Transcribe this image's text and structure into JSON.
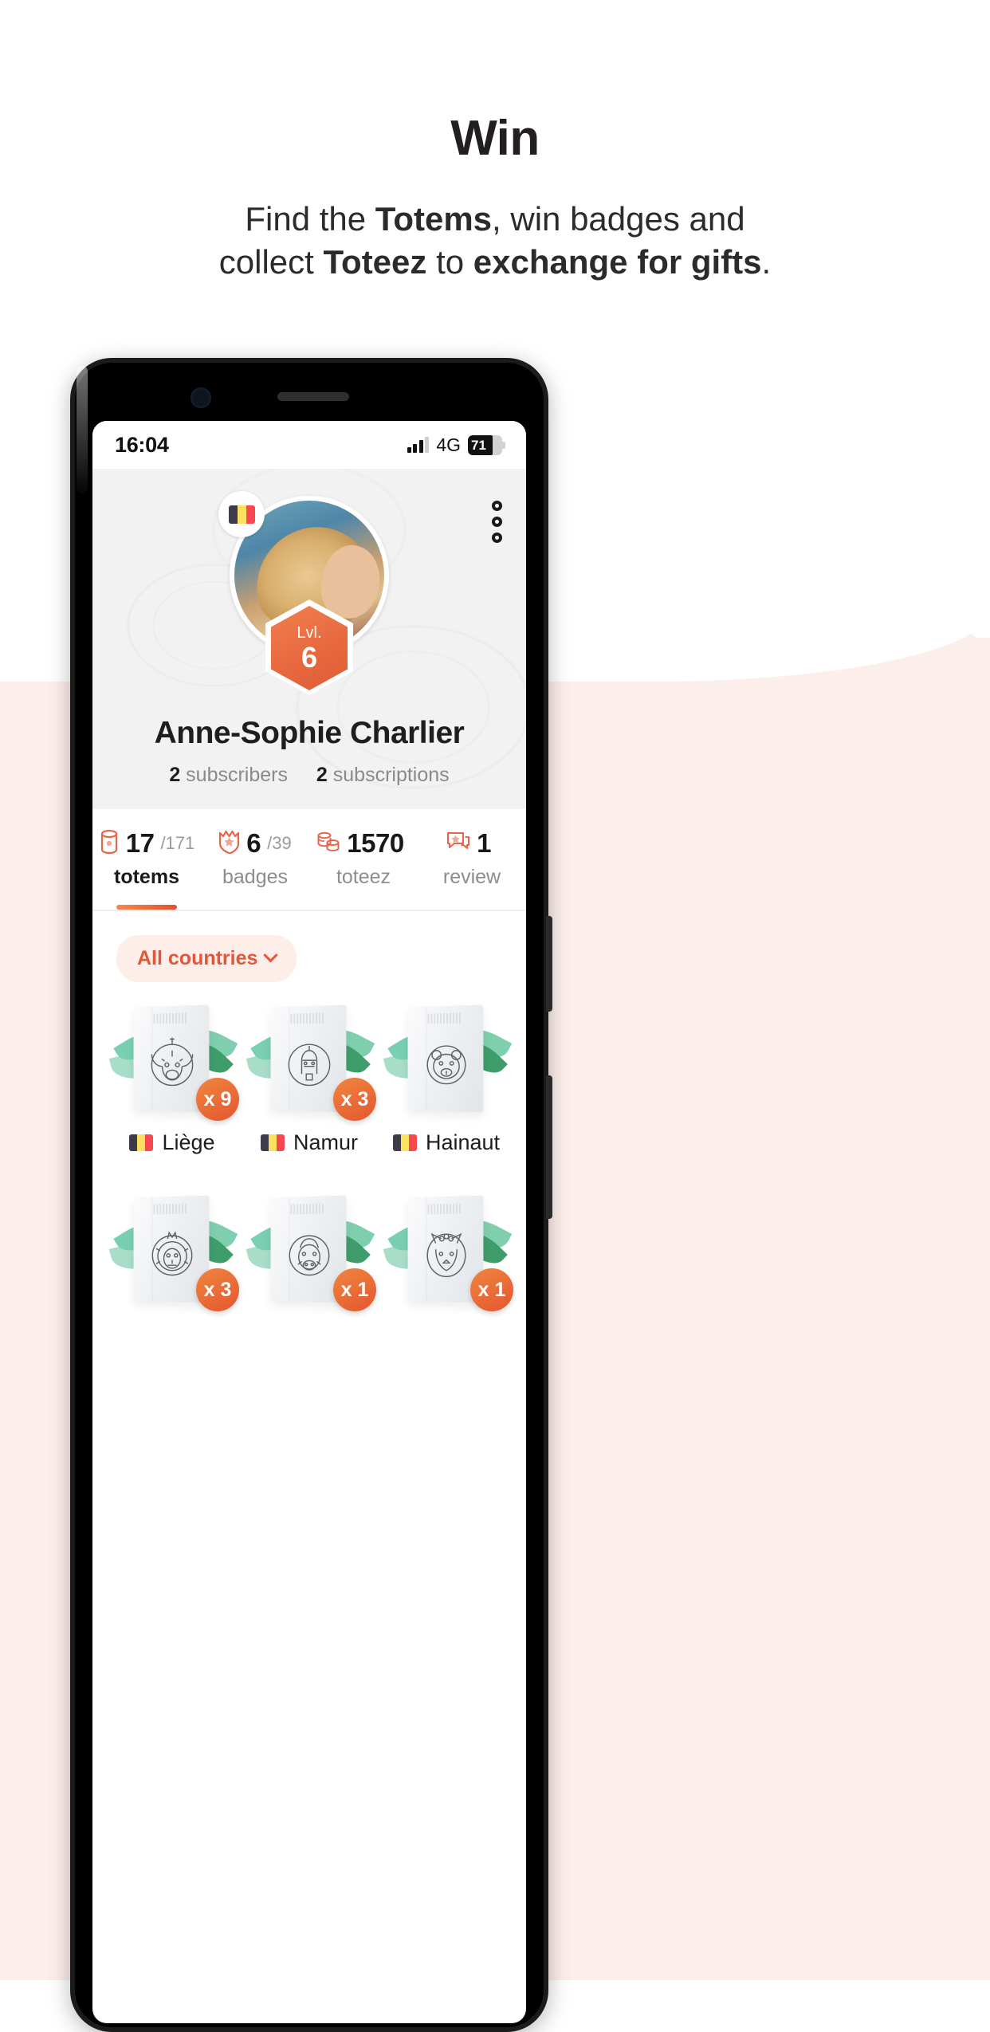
{
  "promo": {
    "headline": "Win",
    "subtitle_line1_a": "Find the ",
    "subtitle_line1_b": "Totems",
    "subtitle_line1_c": ", win badges and",
    "subtitle_line2_a": "collect ",
    "subtitle_line2_b": "Toteez",
    "subtitle_line2_c": " to ",
    "subtitle_line2_d": "exchange for gifts",
    "subtitle_line2_e": "."
  },
  "status_bar": {
    "time": "16:04",
    "network": "4G",
    "battery_percent": "71",
    "signal_bars_filled": 3,
    "signal_bars_total": 4
  },
  "profile": {
    "name": "Anne-Sophie Charlier",
    "country_flag": "belgium-flag",
    "level_label": "Lvl.",
    "level_value": "6",
    "subscribers_count": "2",
    "subscribers_label": "subscribers",
    "subscriptions_count": "2",
    "subscriptions_label": "subscriptions",
    "menu_icon": "more-vertical-icon"
  },
  "stats": [
    {
      "icon": "totem-icon",
      "value": "17",
      "denominator": "/171",
      "label": "totems",
      "active": true
    },
    {
      "icon": "badge-shield-icon",
      "value": "6",
      "denominator": "/39",
      "label": "badges",
      "active": false
    },
    {
      "icon": "coins-icon",
      "value": "1570",
      "denominator": "",
      "label": "toteez",
      "active": false
    },
    {
      "icon": "review-icon",
      "value": "1",
      "denominator": "",
      "label": "review",
      "active": false
    }
  ],
  "filter": {
    "label": "All countries",
    "chevron": "chevron-down-icon"
  },
  "badges": [
    {
      "emblem": "bull-icon",
      "quantity": "x 9",
      "region": "Liège",
      "flag": "belgium-flag"
    },
    {
      "emblem": "mask-icon",
      "quantity": "x 3",
      "region": "Namur",
      "flag": "belgium-flag"
    },
    {
      "emblem": "bear-icon",
      "quantity": "",
      "region": "Hainaut",
      "flag": "belgium-flag"
    },
    {
      "emblem": "lion-icon",
      "quantity": "x 3",
      "region": "",
      "flag": "belgium-flag"
    },
    {
      "emblem": "boar-icon",
      "quantity": "x 1",
      "region": "",
      "flag": "belgium-flag"
    },
    {
      "emblem": "fox-icon",
      "quantity": "x 1",
      "region": "",
      "flag": "belgium-flag"
    }
  ],
  "colors": {
    "accent_orange": "#e4562f",
    "accent_light": "#fdeee9",
    "page_blush": "#fceeea",
    "text_dark": "#1e1e1e",
    "text_muted": "#8d8d8d"
  }
}
